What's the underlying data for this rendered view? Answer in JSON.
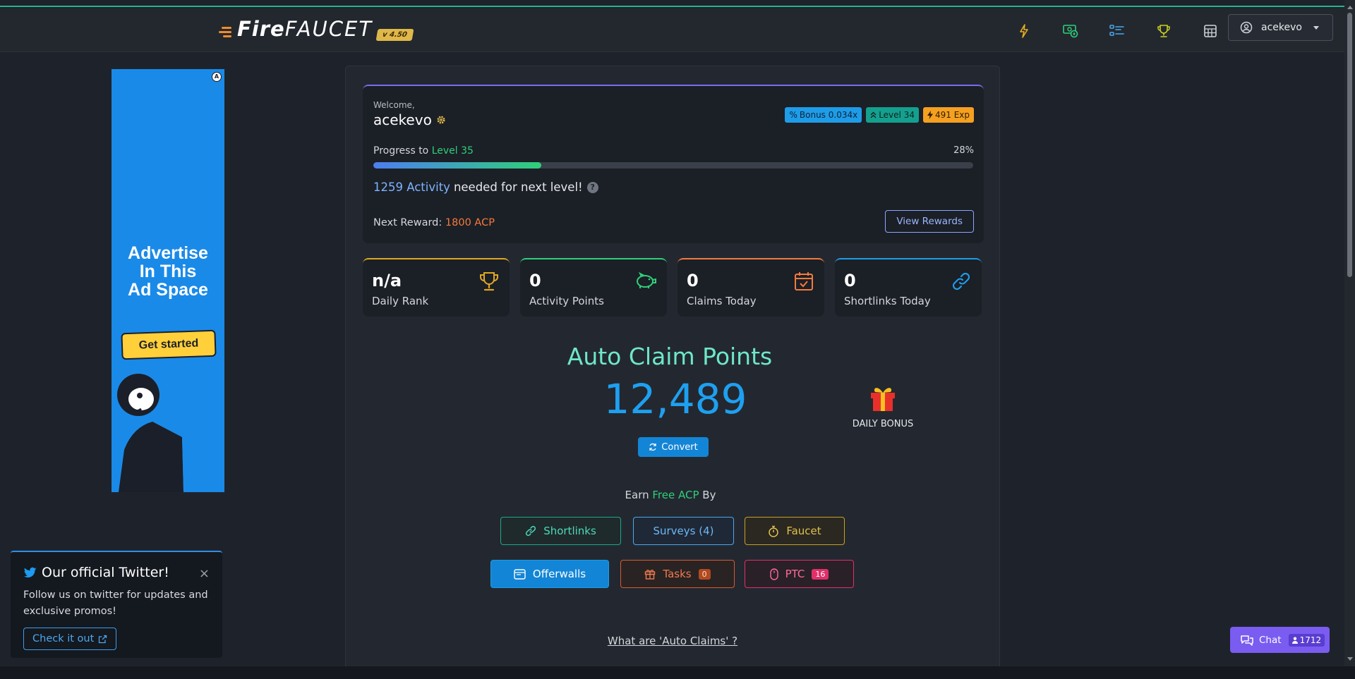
{
  "header": {
    "logo_fire": "Fire",
    "logo_faucet": "FAUCET",
    "version": "v 4.50",
    "nav_icons": [
      "bolt-icon",
      "money-icon",
      "tasks-list-icon",
      "trophy-icon",
      "calculator-icon"
    ],
    "username": "acekevo"
  },
  "ad": {
    "line1": "Advertise",
    "line2": "In This",
    "line3": "Ad Space",
    "button": "Get started"
  },
  "toast": {
    "title": "Our official Twitter!",
    "body": "Follow us on twitter for updates and exclusive promos!",
    "button": "Check it out",
    "close": "×"
  },
  "welcome": {
    "label": "Welcome,",
    "name": "acekevo",
    "badges": {
      "bonus": "Bonus 0.034x",
      "level": "Level 34",
      "exp": "491 Exp"
    },
    "progress_label": "Progress to ",
    "progress_level": "Level 35",
    "progress_pct": "28%",
    "progress_value": 28,
    "activity_count": "1259 Activity",
    "activity_text": "needed for next level!",
    "reward_label": "Next Reward: ",
    "reward_value": "1800 ACP",
    "view_rewards": "View Rewards"
  },
  "stats": [
    {
      "value": "n/a",
      "label": "Daily Rank",
      "color": "#e0a822"
    },
    {
      "value": "0",
      "label": "Activity Points",
      "color": "#2ed07a"
    },
    {
      "value": "0",
      "label": "Claims Today",
      "color": "#f57a3c"
    },
    {
      "value": "0",
      "label": "Shortlinks Today",
      "color": "#1e9ce8"
    }
  ],
  "acp": {
    "title": "Auto Claim Points",
    "value": "12,489",
    "convert": "Convert",
    "daily_bonus": "DAILY BONUS"
  },
  "earn": {
    "prefix": "Earn ",
    "highlight": "Free ACP",
    "suffix": " By",
    "buttons": {
      "shortlinks": "Shortlinks",
      "surveys": "Surveys (4)",
      "faucet": "Faucet",
      "offerwalls": "Offerwalls",
      "tasks": "Tasks",
      "tasks_count": "0",
      "ptc": "PTC",
      "ptc_count": "16"
    }
  },
  "what_are": "What are 'Auto Claims' ?",
  "chat": {
    "label": "Chat",
    "count": "1712"
  }
}
